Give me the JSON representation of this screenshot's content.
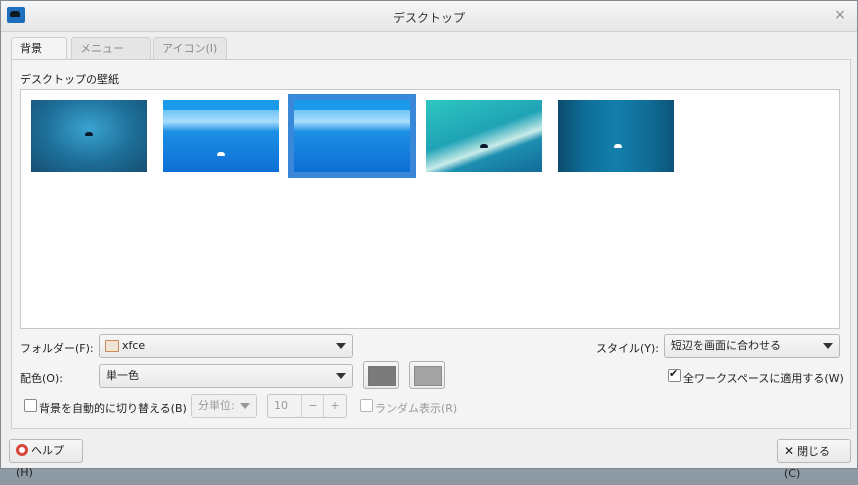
{
  "window": {
    "title": "デスクトップ"
  },
  "tabs": [
    {
      "label": "背景(B)"
    },
    {
      "label": "メニュー(M)"
    },
    {
      "label": "アイコン(I)"
    }
  ],
  "wallpaper": {
    "section_label": "デスクトップの壁紙"
  },
  "folder": {
    "label": "フォルダー(F):",
    "value": "xfce",
    "icon": "folder-icon"
  },
  "style": {
    "label": "スタイル(Y):",
    "value": "短辺を画面に合わせる"
  },
  "color": {
    "label": "配色(O):",
    "value": "単一色",
    "swatch1": "#7b7b7b",
    "swatch2": "#a3a3a3"
  },
  "apply_all": {
    "label": "全ワークスペースに適用する(W)",
    "checked": true
  },
  "auto_change": {
    "label": "背景を自動的に切り替える(B)",
    "checked": false
  },
  "interval": {
    "unit": "分単位:",
    "value": "10",
    "minus": "−",
    "plus": "+"
  },
  "random": {
    "label": "ランダム表示(R)",
    "checked": false
  },
  "buttons": {
    "help": "ヘルプ(H)",
    "close": "閉じる(C)"
  },
  "colors": {
    "accent": "#3a86d8"
  }
}
